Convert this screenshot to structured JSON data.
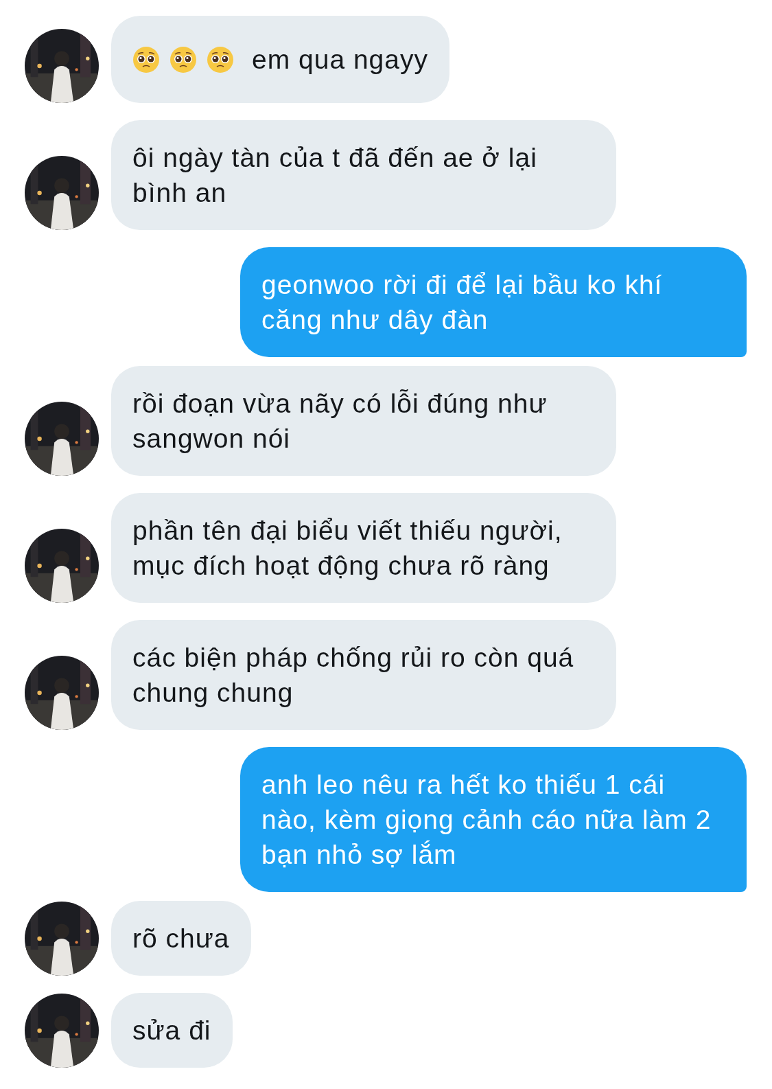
{
  "messages": [
    {
      "kind": "received",
      "emojis": [
        {
          "kind": "pleading"
        },
        {
          "kind": "pleading"
        },
        {
          "kind": "pleading"
        }
      ],
      "text": "em qua ngayy"
    },
    {
      "kind": "received",
      "text": "ôi ngày tàn của t đã đến ae ở lại bình an"
    },
    {
      "kind": "sent",
      "text": "geonwoo rời đi để lại bầu ko khí căng như dây đàn"
    },
    {
      "kind": "received",
      "text": "rồi đoạn vừa nãy có lỗi đúng như sangwon nói"
    },
    {
      "kind": "received",
      "text": "phần tên đại biểu viết thiếu người, mục đích hoạt động chưa rõ ràng"
    },
    {
      "kind": "received",
      "text": "các biện pháp chống rủi ro còn quá chung chung"
    },
    {
      "kind": "sent",
      "text": "anh leo nêu ra hết ko thiếu 1 cái nào, kèm giọng cảnh cáo nữa làm 2 bạn nhỏ sợ lắm"
    },
    {
      "kind": "received",
      "text": "rõ chưa"
    },
    {
      "kind": "received",
      "text": "sửa đi"
    }
  ]
}
